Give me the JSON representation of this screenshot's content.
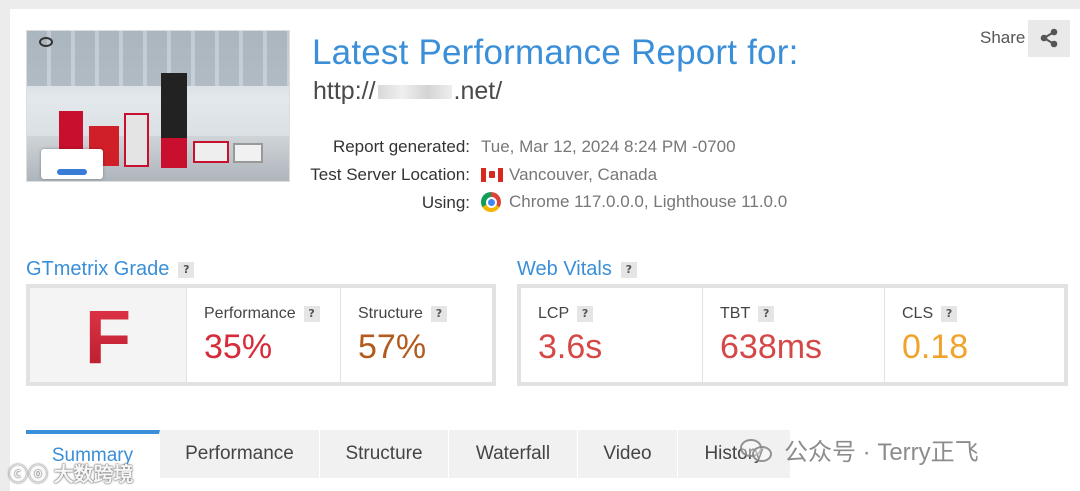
{
  "header": {
    "title": "Latest Performance Report for:",
    "url_prefix": "http://",
    "url_suffix": ".net/",
    "share_label": "Share"
  },
  "meta": {
    "report_generated_label": "Report generated:",
    "report_generated_value": "Tue, Mar 12, 2024 8:24 PM -0700",
    "server_label": "Test Server Location:",
    "server_value": "Vancouver, Canada",
    "using_label": "Using:",
    "using_value": "Chrome 117.0.0.0, Lighthouse 11.0.0"
  },
  "grade": {
    "title": "GTmetrix Grade",
    "help": "?",
    "letter": "F",
    "performance_label": "Performance",
    "performance_value": "35%",
    "structure_label": "Structure",
    "structure_value": "57%"
  },
  "vitals": {
    "title": "Web Vitals",
    "help": "?",
    "lcp_label": "LCP",
    "lcp_value": "3.6s",
    "tbt_label": "TBT",
    "tbt_value": "638ms",
    "cls_label": "CLS",
    "cls_value": "0.18"
  },
  "colors": {
    "accent": "#3a8fd8",
    "bad": "#d52b3a",
    "structure": "#b35a1f",
    "warn": "#f0a22b"
  },
  "tabs": [
    "Summary",
    "Performance",
    "Structure",
    "Waterfall",
    "Video",
    "History"
  ],
  "watermarks": {
    "wechat": "公众号 · Terry正飞",
    "corner": "大数跨境"
  }
}
